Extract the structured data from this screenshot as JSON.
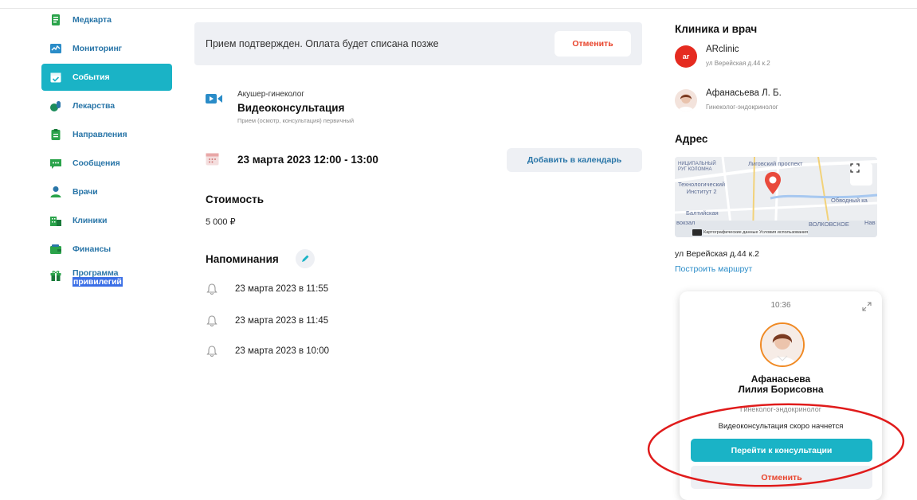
{
  "sidebar": {
    "items": [
      {
        "label": "Медкарта",
        "icon": "medcard-icon",
        "active": false
      },
      {
        "label": "Мониторинг",
        "icon": "monitoring-icon",
        "active": false
      },
      {
        "label": "События",
        "icon": "events-icon",
        "active": true
      },
      {
        "label": "Лекарства",
        "icon": "medicine-icon",
        "active": false
      },
      {
        "label": "Направления",
        "icon": "referrals-icon",
        "active": false
      },
      {
        "label": "Сообщения",
        "icon": "messages-icon",
        "active": false
      },
      {
        "label": "Врачи",
        "icon": "doctors-icon",
        "active": false
      },
      {
        "label": "Клиники",
        "icon": "clinics-icon",
        "active": false
      },
      {
        "label": "Финансы",
        "icon": "finance-icon",
        "active": false
      }
    ],
    "program": {
      "line1": "Программа",
      "line2": "привилегий",
      "icon": "gift-icon"
    }
  },
  "banner": {
    "message": "Прием подтвержден. Оплата будет списана позже",
    "cancel_label": "Отменить"
  },
  "appointment": {
    "specialty": "Акушер-гинеколог",
    "type": "Видеоконсультация",
    "subtype": "Прием (осмотр, консультация) первичный",
    "datetime": "23 марта 2023 12:00 - 13:00",
    "add_to_calendar": "Добавить в календарь",
    "cost_title": "Стоимость",
    "cost_value": "5 000 ₽"
  },
  "reminders": {
    "title": "Напоминания",
    "items": [
      "23 марта 2023 в 11:55",
      "23 марта 2023 в 11:45",
      "23 марта 2023 в 10:00"
    ]
  },
  "clinic_section": {
    "title": "Клиника и врач",
    "clinic_name": "ARclinic",
    "clinic_logo_text": "ar",
    "clinic_address": "ул Верейская д.44 к.2",
    "doctor_name": "Афанасьева Л. Б.",
    "doctor_role": "Гинеколог-эндокринолог"
  },
  "address_section": {
    "title": "Адрес",
    "map_labels": {
      "top_left": "НИЦИПАЛЬНЫЙ\nРУГ КОЛОМНА",
      "street": "Лиговский проспект",
      "institute": "Технологический\nИнститут 2",
      "canal": "Обводный ка",
      "station": "Балтийская",
      "vokzal": "вокзал",
      "volkovskoe": "ВОЛКОВСКОЕ",
      "nav": "Нав"
    },
    "map_attribution": "Картографические данные   Условия использования",
    "address": "ул Верейская д.44 к.2",
    "route_link": "Построить маршрут"
  },
  "call_widget": {
    "time": "10:36",
    "doctor_first_line": "Афанасьева",
    "doctor_second_line": "Лилия Борисовна",
    "role": "Гинеколог-эндокринолог",
    "status": "Видеоконсультация скоро начнется",
    "go_button": "Перейти к консультации",
    "cancel_button": "Отменить"
  },
  "colors": {
    "accent": "#1ab3c6",
    "link": "#2a76a8",
    "danger": "#e8442c",
    "annotation": "#e01b1b"
  }
}
